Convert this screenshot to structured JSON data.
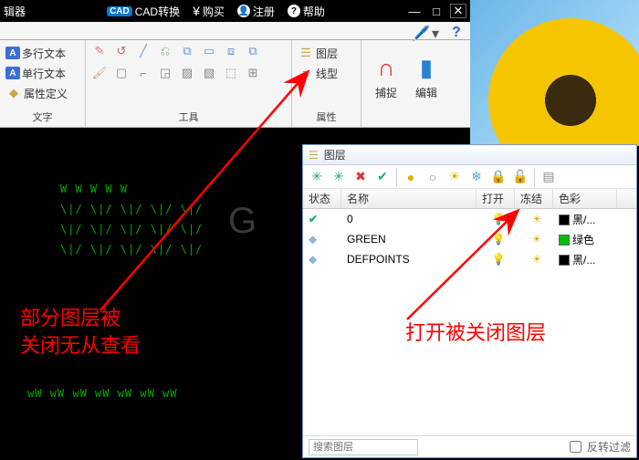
{
  "title": {
    "editor_label": "辑器",
    "cad_badge": "CAD",
    "cad_convert": "CAD转换",
    "buy": "购买",
    "register": "注册",
    "help": "帮助"
  },
  "ribbon": {
    "text_group": {
      "multi_text": "多行文本",
      "single_text": "单行文本",
      "attr_def": "属性定义",
      "label": "文字"
    },
    "tools_group": {
      "label": "工具"
    },
    "props_group": {
      "layer": "图层",
      "linetype": "线型",
      "label": "属性"
    },
    "capture_group": {
      "capture": "捕捉",
      "edit": "编辑"
    }
  },
  "layer_panel": {
    "title": "图层",
    "columns": {
      "state": "状态",
      "name": "名称",
      "open": "打开",
      "freeze": "冻结",
      "color": "色彩"
    },
    "rows": [
      {
        "state": "current",
        "name": "0",
        "open": true,
        "freeze": false,
        "color": "#000000",
        "color_label": "黑/..."
      },
      {
        "state": "normal",
        "name": "GREEN",
        "open": false,
        "freeze": false,
        "color": "#00c000",
        "color_label": "绿色"
      },
      {
        "state": "normal",
        "name": "DEFPOINTS",
        "open": false,
        "freeze": false,
        "color": "#000000",
        "color_label": "黑/..."
      }
    ],
    "search_placeholder": "搜索图层",
    "invert_filter": "反转过滤"
  },
  "annotations": {
    "left": "部分图层被\n关闭无从查看",
    "right": "打开被关闭图层"
  },
  "icons": {
    "yen": "¥",
    "user": "👤",
    "help": "?",
    "layers": "layers-icon",
    "linetype": "linetype-icon",
    "magnet": "🧲",
    "clipboard": "📋",
    "star": "✳",
    "bulb_on": "💡",
    "bulb_off": "💡",
    "sun": "☀",
    "check": "✔",
    "diamond": "◆"
  }
}
